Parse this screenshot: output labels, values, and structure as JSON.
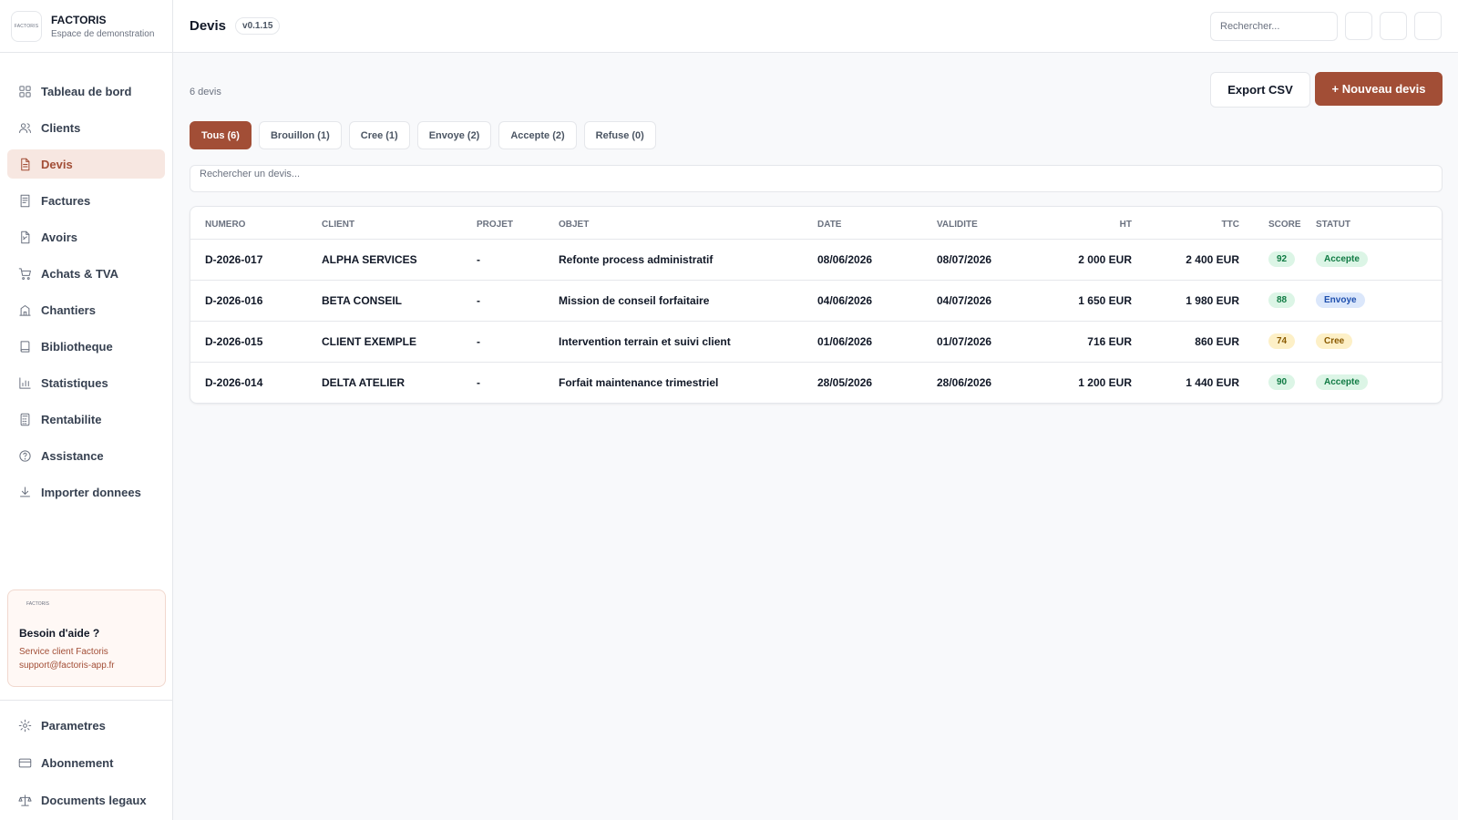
{
  "brand": {
    "logo_text": "FACTORIS",
    "name": "FACTORIS",
    "subtitle": "Espace de demonstration"
  },
  "sidebar": {
    "items": [
      {
        "label": "Tableau de bord",
        "icon": "grid-icon"
      },
      {
        "label": "Clients",
        "icon": "users-icon"
      },
      {
        "label": "Devis",
        "icon": "document-icon",
        "active": true
      },
      {
        "label": "Factures",
        "icon": "receipt-icon"
      },
      {
        "label": "Avoirs",
        "icon": "credit-note-icon"
      },
      {
        "label": "Achats & TVA",
        "icon": "cart-icon"
      },
      {
        "label": "Chantiers",
        "icon": "building-icon"
      },
      {
        "label": "Bibliotheque",
        "icon": "book-icon"
      },
      {
        "label": "Statistiques",
        "icon": "bar-chart-icon"
      },
      {
        "label": "Rentabilite",
        "icon": "calculator-icon"
      },
      {
        "label": "Assistance",
        "icon": "help-circle-icon"
      },
      {
        "label": "Importer donnees",
        "icon": "download-icon"
      }
    ],
    "help": {
      "logo_text": "FACTORIS",
      "title": "Besoin d'aide ?",
      "line1": "Service client Factoris",
      "line2": "support@factoris-app.fr"
    },
    "bottom_items": [
      {
        "label": "Parametres",
        "icon": "settings-icon"
      },
      {
        "label": "Abonnement",
        "icon": "card-icon"
      },
      {
        "label": "Documents legaux",
        "icon": "scale-icon"
      }
    ]
  },
  "header": {
    "title": "Devis",
    "version": "v0.1.15",
    "search_placeholder": "Rechercher..."
  },
  "main": {
    "count": "6 devis",
    "export_label": "Export CSV",
    "new_label": "+ Nouveau devis",
    "tabs": [
      {
        "label": "Tous (6)",
        "active": true
      },
      {
        "label": "Brouillon (1)"
      },
      {
        "label": "Cree (1)"
      },
      {
        "label": "Envoye (2)"
      },
      {
        "label": "Accepte (2)"
      },
      {
        "label": "Refuse (0)"
      }
    ],
    "search_placeholder": "Rechercher un devis..."
  },
  "table": {
    "columns": [
      "NUMERO",
      "CLIENT",
      "PROJET",
      "OBJET",
      "DATE",
      "VALIDITE",
      "HT",
      "TTC",
      "SCORE",
      "STATUT"
    ],
    "rows": [
      {
        "numero": "D-2026-017",
        "client": "ALPHA SERVICES",
        "projet": "-",
        "objet": "Refonte process administratif",
        "date": "08/06/2026",
        "validite": "08/07/2026",
        "ht": "2 000 EUR",
        "ttc": "2 400 EUR",
        "score": "92",
        "statut": "Accepte",
        "score_tone": "green",
        "statut_tone": "green"
      },
      {
        "numero": "D-2026-016",
        "client": "BETA CONSEIL",
        "projet": "-",
        "objet": "Mission de conseil forfaitaire",
        "date": "04/06/2026",
        "validite": "04/07/2026",
        "ht": "1 650 EUR",
        "ttc": "1 980 EUR",
        "score": "88",
        "statut": "Envoye",
        "score_tone": "green",
        "statut_tone": "blue"
      },
      {
        "numero": "D-2026-015",
        "client": "CLIENT EXEMPLE",
        "projet": "-",
        "objet": "Intervention terrain et suivi client",
        "date": "01/06/2026",
        "validite": "01/07/2026",
        "ht": "716 EUR",
        "ttc": "860 EUR",
        "score": "74",
        "statut": "Cree",
        "score_tone": "amber",
        "statut_tone": "amber"
      },
      {
        "numero": "D-2026-014",
        "client": "DELTA ATELIER",
        "projet": "-",
        "objet": "Forfait maintenance trimestriel",
        "date": "28/05/2026",
        "validite": "28/06/2026",
        "ht": "1 200 EUR",
        "ttc": "1 440 EUR",
        "score": "90",
        "statut": "Accepte",
        "score_tone": "green",
        "statut_tone": "green"
      }
    ]
  },
  "colors": {
    "accent": "#a24e36",
    "accent_soft": "#f7e7e1",
    "green_bg": "#dcf5e6",
    "green_fg": "#0f7a43",
    "blue_bg": "#dbe7fb",
    "blue_fg": "#1e4fae",
    "amber_bg": "#fdf0c7",
    "amber_fg": "#8a5a00"
  }
}
